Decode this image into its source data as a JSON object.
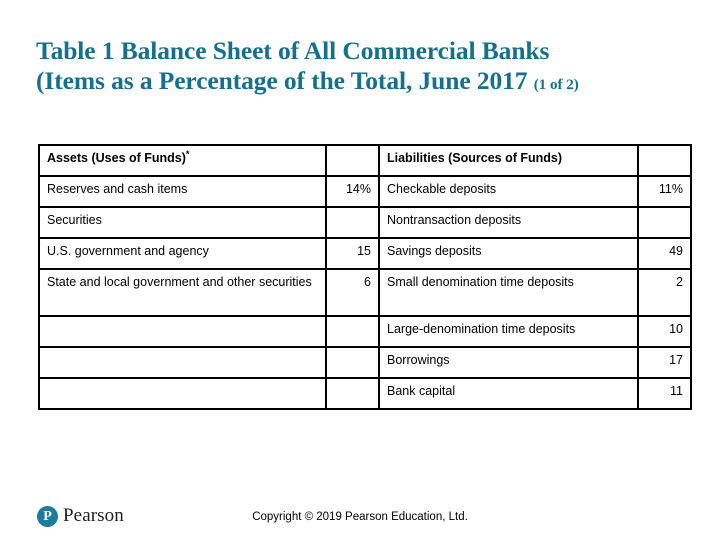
{
  "title": {
    "line1": "Table 1 Balance Sheet of All Commercial Banks",
    "line2": "(Items as a Percentage of the Total, June 2017",
    "suffix": "(1 of 2)",
    "color": "#14708E"
  },
  "table": {
    "headers": {
      "assets": "Assets (Uses of Funds)",
      "assets_footnote_marker": "*",
      "assets_value": "",
      "liabilities": "Liabilities (Sources of Funds)",
      "liabilities_value": ""
    },
    "rows": [
      {
        "asset_label": "Reserves and cash items",
        "asset_value": "14%",
        "liability_label": "Checkable deposits",
        "liability_value": "11%"
      },
      {
        "asset_label": "Securities",
        "asset_value": "",
        "liability_label": "Nontransaction deposits",
        "liability_value": ""
      },
      {
        "asset_label": "U.S. government and agency",
        "asset_value": "15",
        "liability_label": "Savings deposits",
        "liability_value": "49"
      },
      {
        "asset_label": "State and local government and other securities",
        "asset_value": "6",
        "liability_label": "Small denomination time deposits",
        "liability_value": "2"
      },
      {
        "asset_label": "",
        "asset_value": "",
        "liability_label": "Large-denomination time deposits",
        "liability_value": "10"
      },
      {
        "asset_label": "",
        "asset_value": "",
        "liability_label": "Borrowings",
        "liability_value": "17"
      },
      {
        "asset_label": "",
        "asset_value": "",
        "liability_label": "Bank capital",
        "liability_value": "11"
      }
    ]
  },
  "footer": {
    "logo_mark": "P",
    "logo_wordmark": "Pearson",
    "copyright": "Copyright © 2019 Pearson Education, Ltd.",
    "logo_color": "#1B7C9E"
  }
}
